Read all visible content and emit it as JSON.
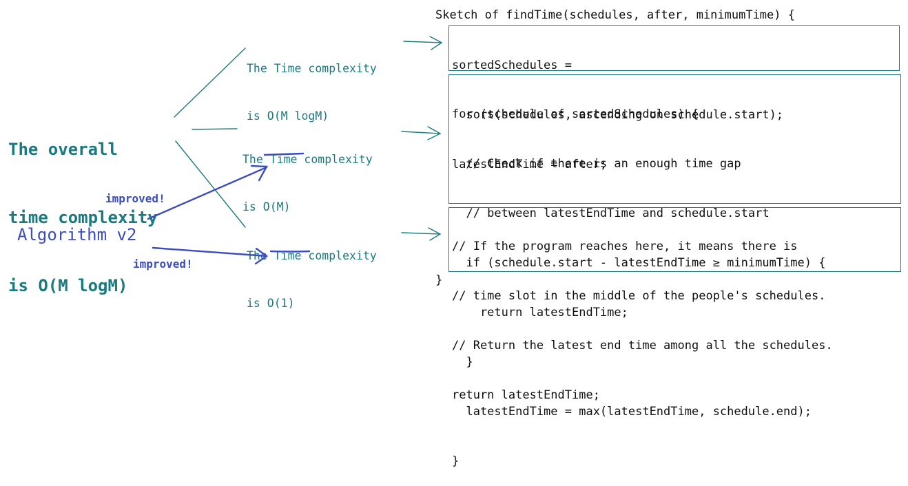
{
  "overall": {
    "line1": "The overall",
    "line2": "time complexity",
    "line3": "is O(M logM)"
  },
  "algorithm_label": "Algorithm v2",
  "improved_upper": "improved!",
  "improved_lower": "improved!",
  "complexities": [
    {
      "line1": "The Time complexity",
      "line2": "is O(M logM)"
    },
    {
      "line1": "The Time complexity",
      "line2": "is O(M)"
    },
    {
      "line1": "The Time complexity",
      "line2": "is O(1)"
    }
  ],
  "code": {
    "header": "Sketch of findTime(schedules, after, minimumTime) {",
    "block1": [
      "sortedSchedules =",
      "  sort(schedules, ascending on schedule.start);",
      "latestEndTime = after;"
    ],
    "block2": [
      "for (schedule of sortedSchedules) {",
      "  // Check if there is an enough time gap",
      "  // between latestEndTime and schedule.start",
      "  if (schedule.start - latestEndTime ≥ minimumTime) {",
      "    return latestEndTime;",
      "  }",
      "  latestEndTime = max(latestEndTime, schedule.end);",
      "}"
    ],
    "block3": [
      "// If the program reaches here, it means there is",
      "// time slot in the middle of the people's schedules.",
      "// Return the latest end time among all the schedules.",
      "return latestEndTime;"
    ],
    "footer": "}"
  },
  "colors": {
    "teal": "#197a80",
    "blue": "#3b4cc0"
  }
}
